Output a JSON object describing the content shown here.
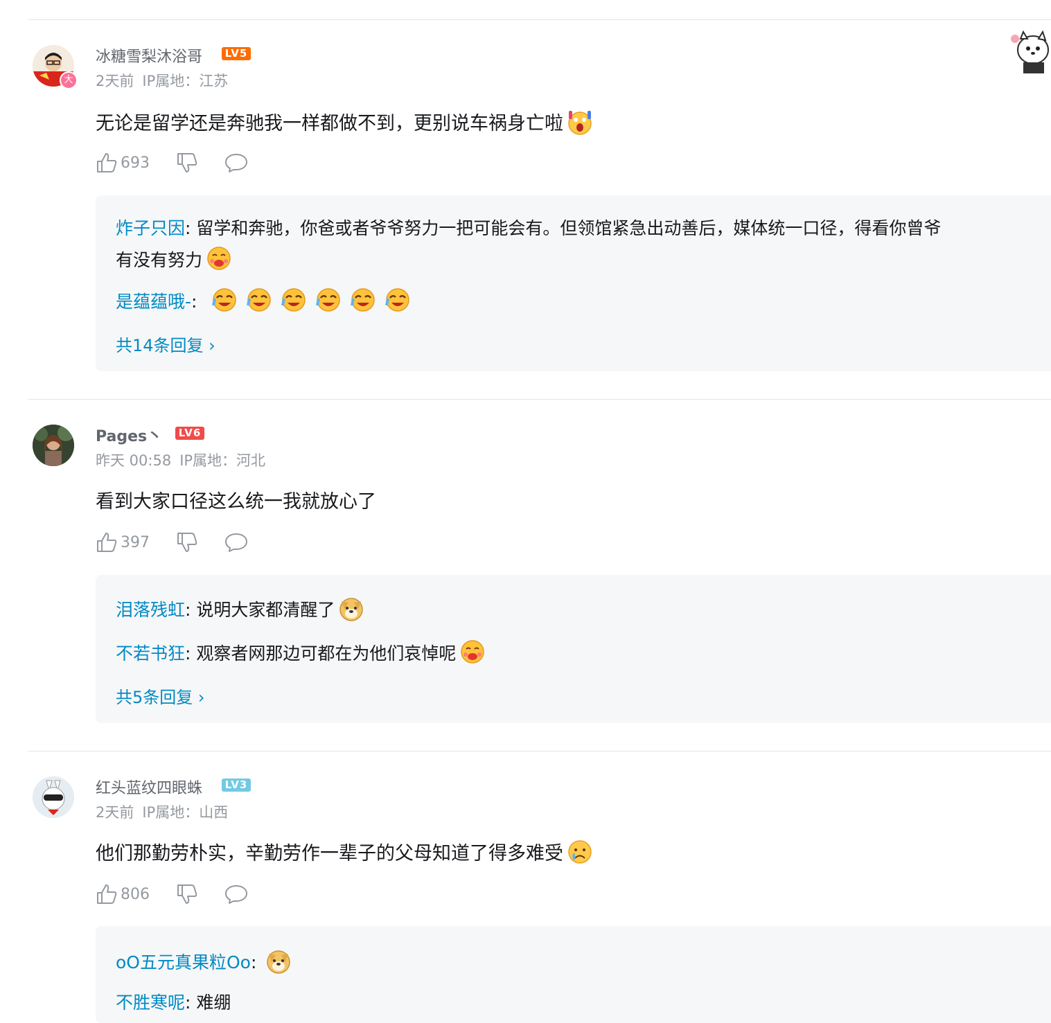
{
  "comments": [
    {
      "username": "冰糖雪梨沐浴哥",
      "level": "LV5",
      "level_color": "#ff6c00",
      "time": "2天前",
      "ip": "IP属地：江苏",
      "content": "无论是留学还是奔驰我一样都做不到，更别说车祸身亡啦",
      "likes": "693",
      "replies": [
        {
          "user": "炸子只因",
          "text": ": 留学和奔驰，你爸或者爷爷努力一把可能会有。但领馆紧急出动善后，媒体统一口径，得看你曾爷",
          "text2": "有没有努力"
        },
        {
          "user": "是蕴蕴哦-",
          "text": ":"
        }
      ],
      "more": "共14条回复 ›"
    },
    {
      "username": "Pages丶",
      "level": "LV6",
      "level_color": "#f04c49",
      "time": "昨天 00:58",
      "ip": "IP属地：河北",
      "content": "看到大家口径这么统一我就放心了",
      "likes": "397",
      "replies": [
        {
          "user": "泪落残虹",
          "text": ": 说明大家都清醒了"
        },
        {
          "user": "不若书狂",
          "text": ": 观察者网那边可都在为他们哀悼呢"
        }
      ],
      "more": "共5条回复 ›"
    },
    {
      "username": "红头蓝纹四眼蛛",
      "level": "LV3",
      "level_color": "#73c9e5",
      "time": "2天前",
      "ip": "IP属地：山西",
      "content": "他们那勤劳朴实，辛勤劳作一辈子的父母知道了得多难受",
      "likes": "806",
      "replies": [
        {
          "user": "oO五元真果粒Oo",
          "text": ":"
        },
        {
          "user": "不胜寒呢",
          "text": ": 难绷"
        }
      ]
    }
  ]
}
